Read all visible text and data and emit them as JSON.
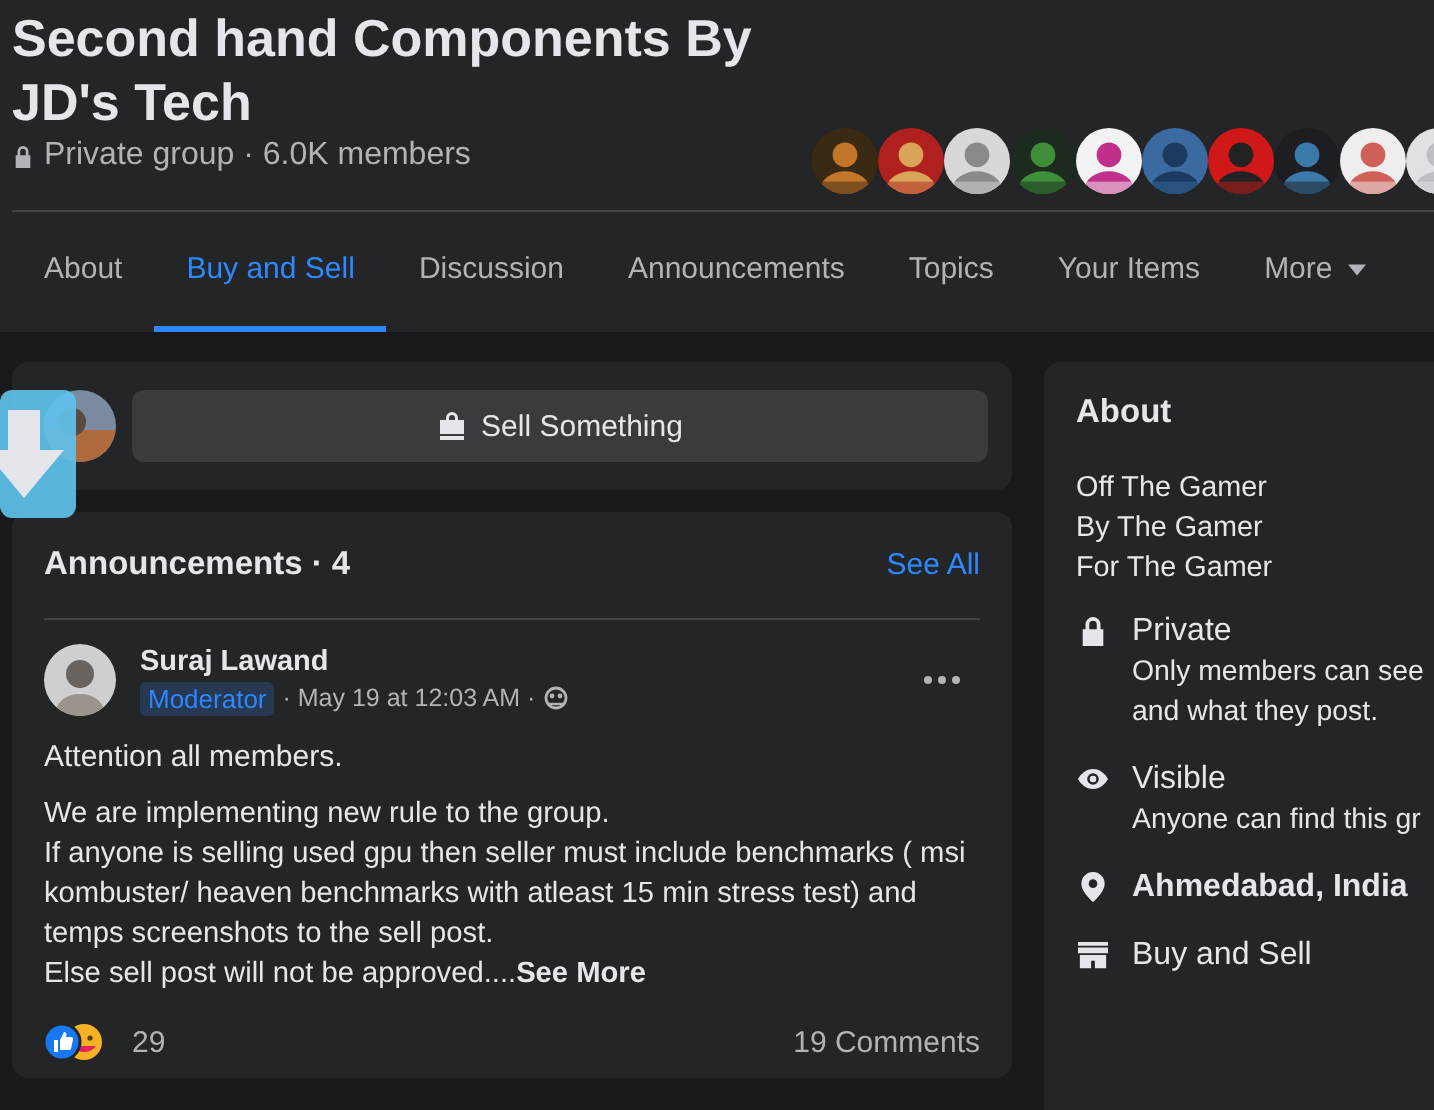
{
  "group": {
    "title": "Second hand Components By JD's Tech",
    "privacy": "Private group · 6.0K members"
  },
  "tabs": [
    {
      "label": "About",
      "selected": false,
      "kind": "tab"
    },
    {
      "label": "Buy and Sell",
      "selected": true,
      "kind": "tab"
    },
    {
      "label": "Discussion",
      "selected": false,
      "kind": "tab"
    },
    {
      "label": "Announcements",
      "selected": false,
      "kind": "tab"
    },
    {
      "label": "Topics",
      "selected": false,
      "kind": "tab"
    },
    {
      "label": "Your Items",
      "selected": false,
      "kind": "tab"
    },
    {
      "label": "More",
      "selected": false,
      "kind": "dropdown"
    }
  ],
  "composer": {
    "button": "Sell Something"
  },
  "announcements": {
    "title": "Announcements · 4",
    "see_all": "See All",
    "post": {
      "author": "Suraj Lawand",
      "badge": "Moderator",
      "time": "· May 19 at 12:03 AM ·",
      "greeting": "Attention all members.",
      "body": [
        "We are implementing new rule to the group.",
        "If anyone is selling used gpu then seller must include benchmarks ( msi kombuster/ heaven benchmarks with atleast 15 min stress test) and temps screenshots to the sell post.",
        "Else sell post will not be approved...."
      ],
      "see_more": "See More",
      "reactions": "29",
      "comments": "19 Comments"
    }
  },
  "about": {
    "title": "About",
    "description": [
      "Off The Gamer",
      "By The Gamer",
      "For The Gamer"
    ],
    "items": [
      {
        "kind": "private",
        "title": "Private",
        "detail": [
          "Only members can see",
          "and what they post."
        ]
      },
      {
        "kind": "visible",
        "title": "Visible",
        "detail": [
          "Anyone can find this gr"
        ]
      },
      {
        "kind": "location",
        "title": "Ahmedabad, India"
      },
      {
        "kind": "category",
        "title": "Buy and Sell"
      }
    ]
  }
}
